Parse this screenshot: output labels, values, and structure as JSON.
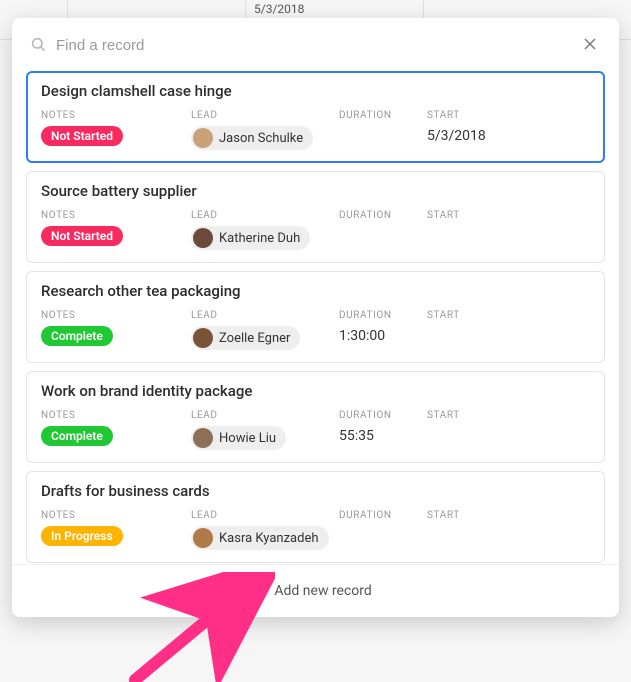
{
  "background": {
    "visible_date": "5/3/2018"
  },
  "search": {
    "placeholder": "Find a record"
  },
  "labels": {
    "notes": "NOTES",
    "lead": "LEAD",
    "duration": "DURATION",
    "start": "START"
  },
  "status_pills": {
    "notstarted": "Not Started",
    "complete": "Complete",
    "inprogress": "In Progress"
  },
  "records": [
    {
      "title": "Design clamshell case hinge",
      "status_key": "notstarted",
      "lead": "Jason Schulke",
      "avatar_bg": "#c9a27a",
      "duration": "",
      "start": "5/3/2018",
      "selected": true
    },
    {
      "title": "Source battery supplier",
      "status_key": "notstarted",
      "lead": "Katherine Duh",
      "avatar_bg": "#6b4a3a",
      "duration": "",
      "start": "",
      "selected": false
    },
    {
      "title": "Research other tea packaging",
      "status_key": "complete",
      "lead": "Zoelle Egner",
      "avatar_bg": "#7a5238",
      "duration": "1:30:00",
      "start": "",
      "selected": false
    },
    {
      "title": "Work on brand identity package",
      "status_key": "complete",
      "lead": "Howie Liu",
      "avatar_bg": "#8c6f56",
      "duration": "55:35",
      "start": "",
      "selected": false
    },
    {
      "title": "Drafts for business cards",
      "status_key": "inprogress",
      "lead": "Kasra Kyanzadeh",
      "avatar_bg": "#b07a48",
      "duration": "",
      "start": "",
      "selected": false
    }
  ],
  "footer": {
    "add_label": "Add new record"
  }
}
